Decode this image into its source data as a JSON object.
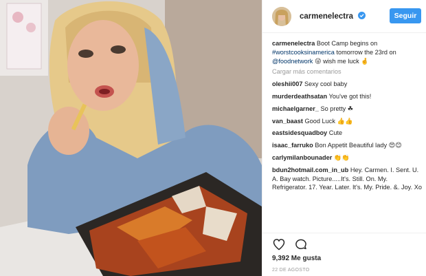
{
  "header": {
    "username": "carmenelectra",
    "follow_label": "Seguir",
    "accent_color": "#3897f0"
  },
  "caption": {
    "username": "carmenelectra",
    "text_1": "Boot Camp begins on",
    "hashtag": "#worstcooksinamerica",
    "text_2": "tomorrow the 23rd on",
    "mention": "@foodnetwork",
    "text_3": "😜 wish me luck 🤞"
  },
  "load_more_label": "Cargar más comentarios",
  "comments": [
    {
      "user": "oleshii007",
      "text": "Sexy cool baby"
    },
    {
      "user": "murderdeathsatan",
      "text": "You've got this!"
    },
    {
      "user": "michaelgarner_",
      "text": "So pretty ☘"
    },
    {
      "user": "van_baast",
      "text": "Good Luck 👍👍"
    },
    {
      "user": "eastsidesquadboy",
      "text": "Cute"
    },
    {
      "user": "isaac_farruko",
      "text": "Bon Appetit Beautiful lady 😍😊"
    },
    {
      "user": "carlymilanbounader",
      "text": "👏👏"
    },
    {
      "user": "bdun2hotmail.com_in_ub",
      "text": "Hey. Carmen. I. Sent. U. A. Bay watch. Picture.....It's. Still. On. My. Refrigerator. 17. Year. Later. It's. My. Pride. &. Joy. Xo"
    }
  ],
  "actions": {
    "like_icon": "heart-icon",
    "comment_icon": "comment-icon"
  },
  "likes_label": "9,392 Me gusta",
  "date_label": "22 DE AGOSTO"
}
